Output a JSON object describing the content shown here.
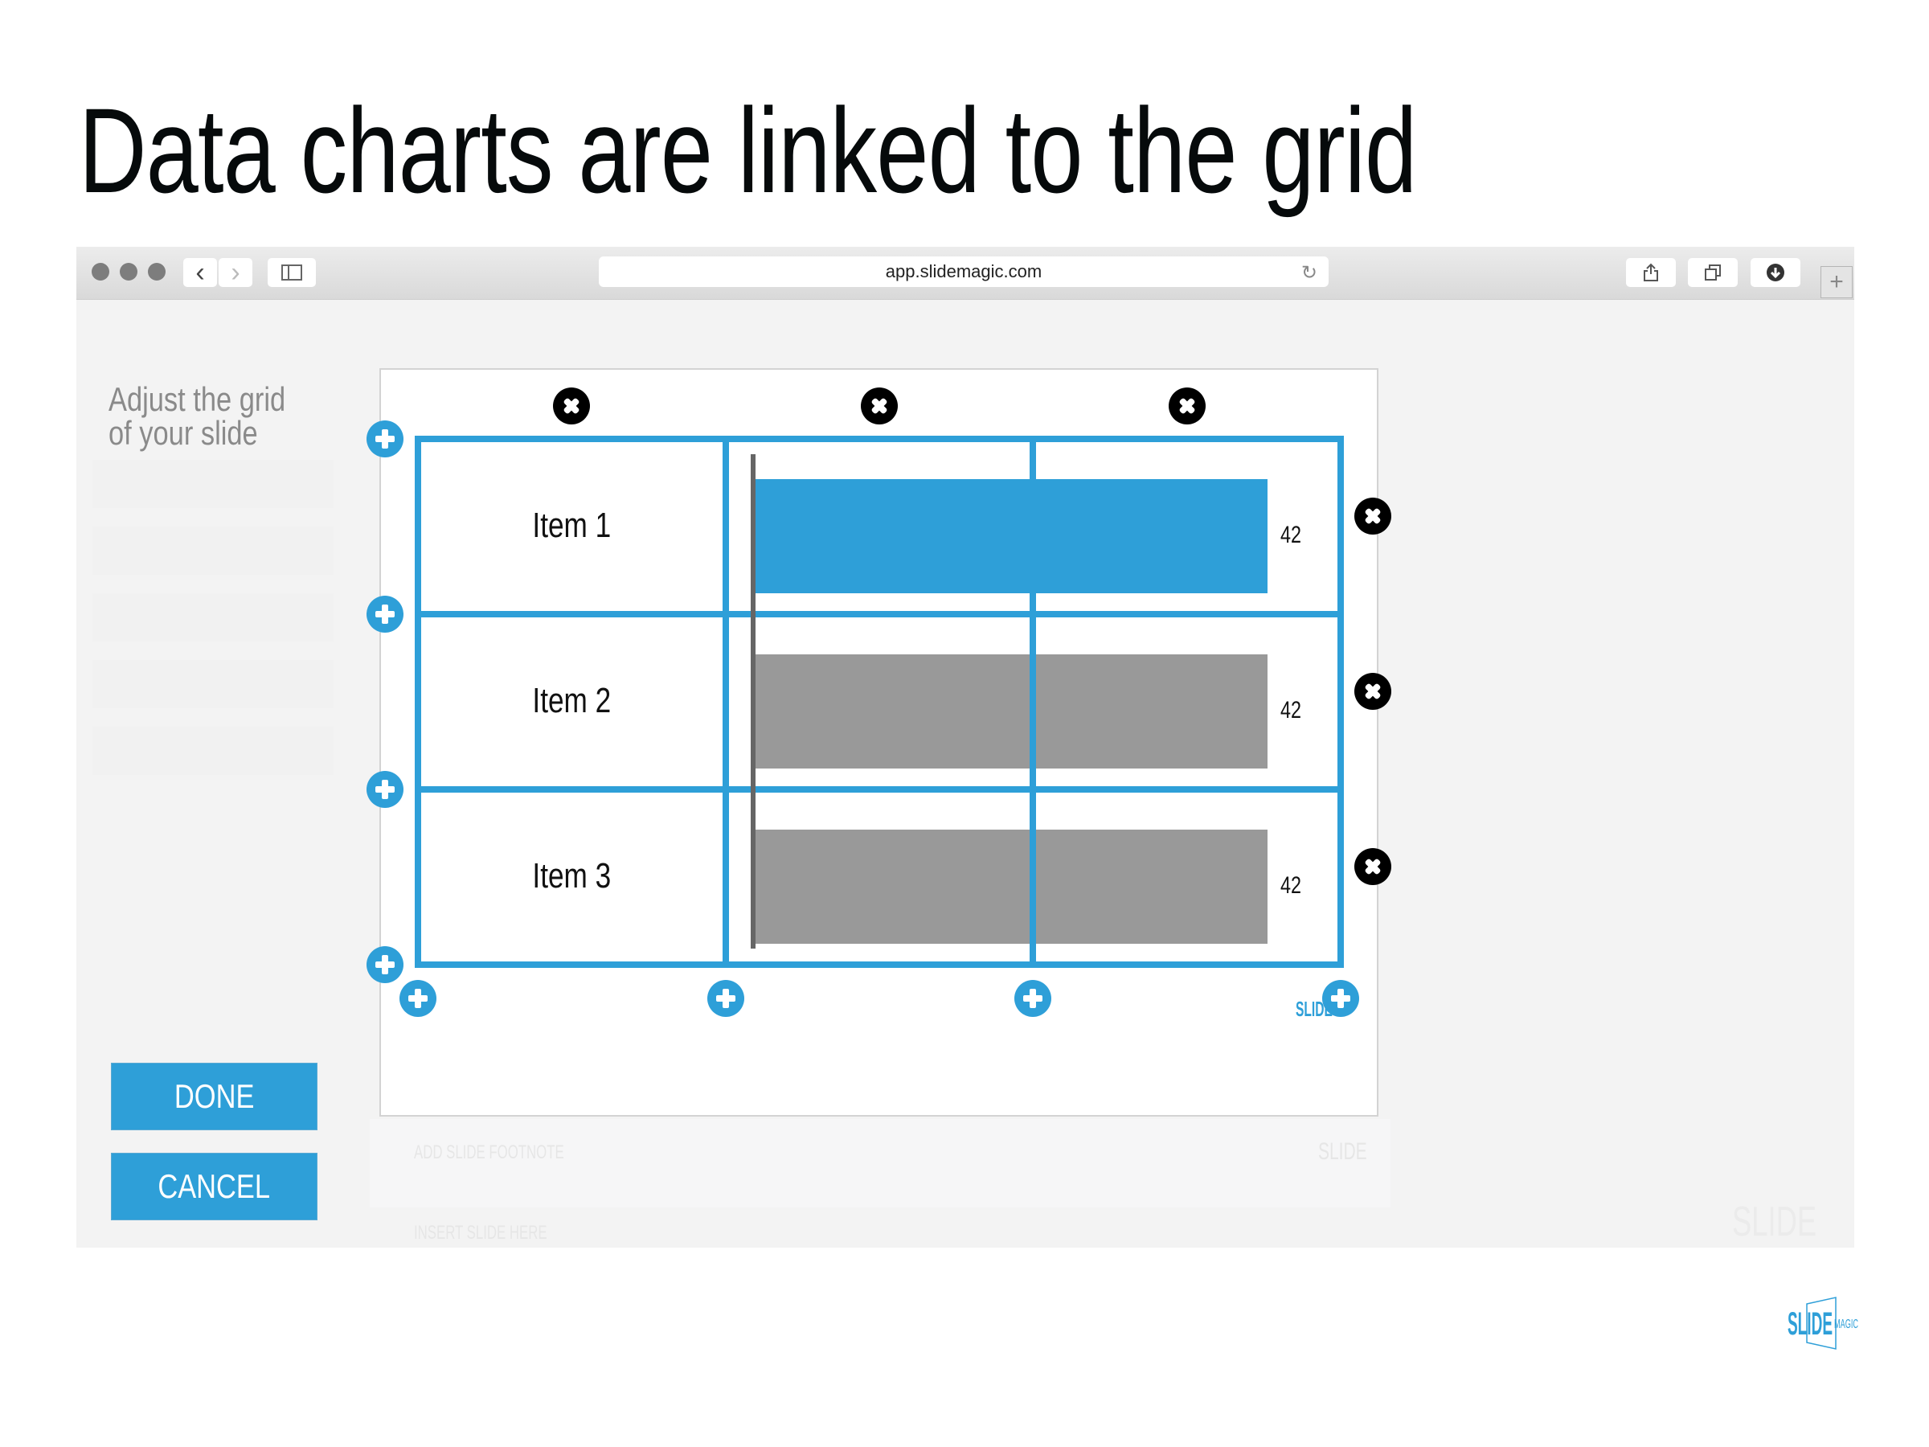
{
  "slide_title": "Data charts are linked to the grid",
  "browser": {
    "url": "app.slidemagic.com",
    "icons": {
      "back": "chevron-left-icon",
      "forward": "chevron-right-icon",
      "sidebar": "sidebar-icon",
      "reload": "reload-icon",
      "share": "share-icon",
      "tabs": "tabs-icon",
      "download": "download-icon",
      "new_tab": "plus-icon"
    },
    "back_glyph": "‹",
    "forward_glyph": "›",
    "reload_glyph": "↻",
    "new_tab_glyph": "+"
  },
  "sidebar": {
    "heading_line1": "Adjust the grid",
    "heading_line2": "of your slide",
    "done_label": "DONE",
    "cancel_label": "CANCEL"
  },
  "editor": {
    "footnote_placeholder": "ADD SLIDE FOOTNOTE",
    "insert_slide_label": "INSERT SLIDE HERE",
    "logo_text": "SLIDE",
    "logo_sub": "MAGIC"
  },
  "grid": {
    "columns": 3,
    "rows": 3,
    "accent_color": "#2e9fd8"
  },
  "chart_data": {
    "type": "bar",
    "orientation": "horizontal",
    "categories": [
      "Item 1",
      "Item 2",
      "Item 3"
    ],
    "values": [
      42,
      42,
      42
    ],
    "value_labels": [
      "42",
      "42",
      "42"
    ],
    "colors": [
      "#2e9fd8",
      "#999999",
      "#999999"
    ],
    "title": "",
    "xlabel": "",
    "ylabel": "",
    "xlim": [
      0,
      42
    ]
  },
  "brand_logo": {
    "text_main": "SLIDE",
    "text_sub": "MAGIC",
    "color": "#2e9fd8"
  }
}
